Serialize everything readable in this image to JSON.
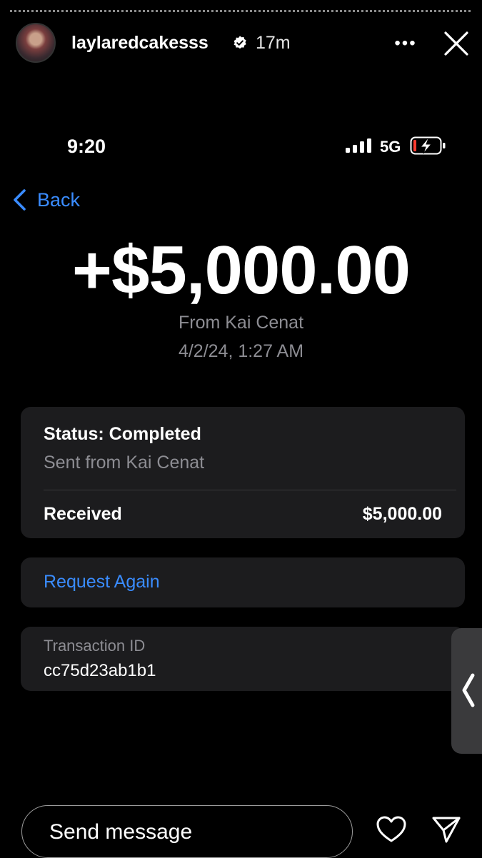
{
  "story": {
    "username": "laylaredcakesss",
    "time_ago": "17m",
    "more_label": "•••"
  },
  "phone": {
    "status_time": "9:20",
    "network": "5G"
  },
  "nav": {
    "back_label": "Back"
  },
  "transaction": {
    "amount": "+$5,000.00",
    "from": "From Kai Cenat",
    "date": "4/2/24, 1:27 AM",
    "status_title": "Status: Completed",
    "status_sub": "Sent from Kai Cenat",
    "received_label": "Received",
    "received_value": "$5,000.00",
    "request_again_label": "Request Again",
    "txn_id_label": "Transaction ID",
    "txn_id_value": "cc75d23ab1b1"
  },
  "composer": {
    "placeholder": "Send message"
  },
  "colors": {
    "accent_blue": "#3a8cff",
    "card_bg": "#1c1c1e",
    "secondary_text": "#8d8d93",
    "battery_red": "#ff3b30"
  },
  "icons": {
    "verified": "verified-badge-icon",
    "close": "close-icon",
    "back": "chevron-left-icon",
    "signal": "cellular-signal-icon",
    "battery": "battery-charging-icon",
    "heart": "heart-icon",
    "send": "send-icon",
    "side": "chevron-left-icon"
  }
}
